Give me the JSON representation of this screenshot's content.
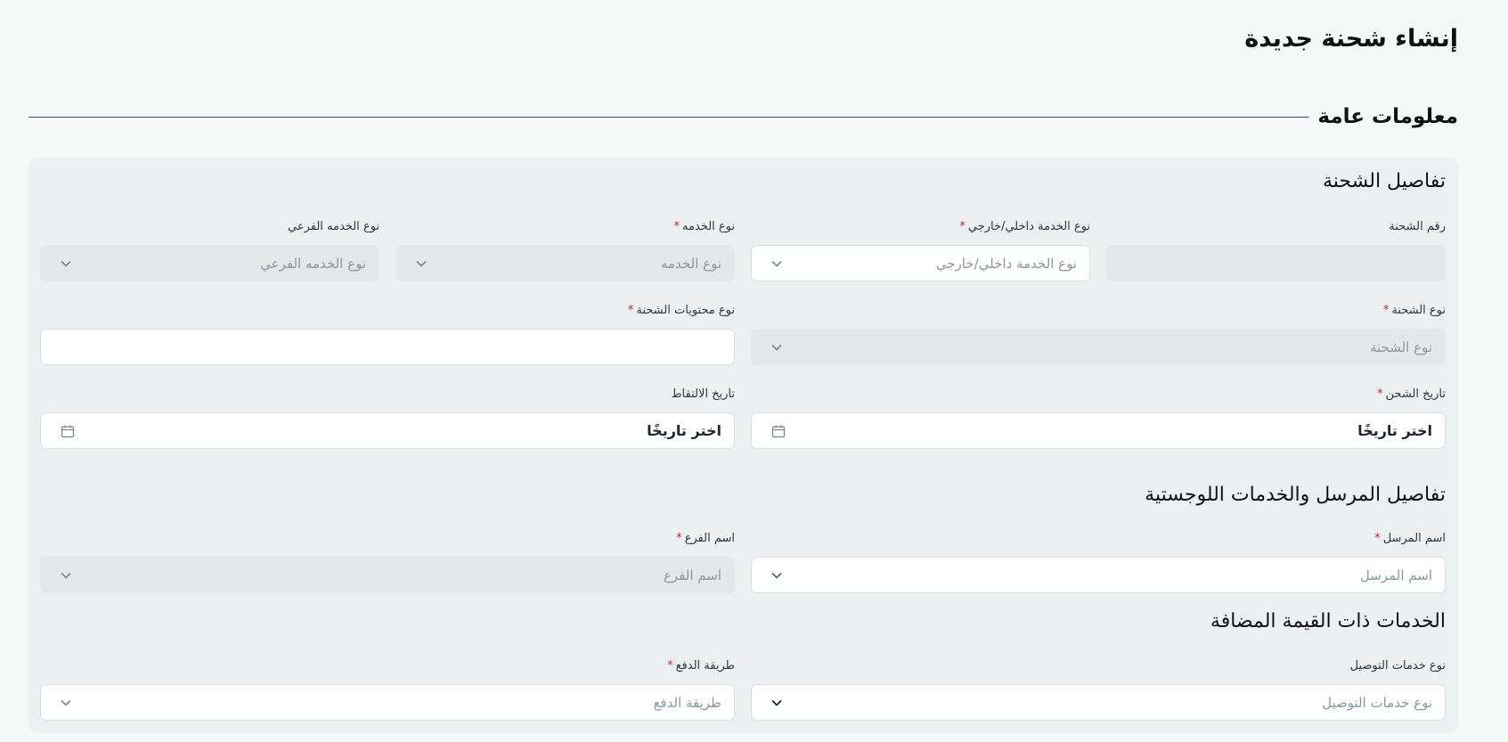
{
  "page": {
    "title": "إنشاء شحنة جديدة"
  },
  "general": {
    "section_title": "معلومات عامة"
  },
  "shipment_details": {
    "title": "تفاصيل الشحنة",
    "shipment_number": {
      "label": "رقم الشحنة",
      "value": ""
    },
    "service_scope": {
      "label": "نوع الخدمة داخلي/خارجي",
      "required": "*",
      "placeholder": "نوع الخدمة داخلي/خارجي"
    },
    "service_type": {
      "label": "نوع الخدمه",
      "required": "*",
      "placeholder": "نوع الخدمه"
    },
    "sub_service_type": {
      "label": "نوع الخدمه الفرعي",
      "placeholder": "نوع الخدمه الفرعي"
    },
    "shipment_type": {
      "label": "نوع الشحنة",
      "required": "*",
      "placeholder": "نوع الشحنة"
    },
    "contents_type": {
      "label": "نوع محتويات الشحنة",
      "required": "*",
      "value": ""
    },
    "ship_date": {
      "label": "تاريخ الشحن",
      "required": "*",
      "value": "اختر تاريخًا"
    },
    "pickup_date": {
      "label": "تاريخ الالتقاط",
      "value": "اختر تاريخًا"
    }
  },
  "sender_details": {
    "title": "تفاصيل المرسل والخدمات اللوجستية",
    "sender_name": {
      "label": "اسم المرسل",
      "required": "*",
      "placeholder": "اسم المرسل"
    },
    "branch_name": {
      "label": "اسم الفرع",
      "required": "*",
      "placeholder": "اسم الفرع"
    }
  },
  "value_added": {
    "title": "الخدمات ذات القيمة المضافة",
    "delivery_services": {
      "label": "نوع خدمات التوصيل",
      "placeholder": "نوع خدمات التوصيل"
    },
    "payment_method": {
      "label": "طريقة الدفع",
      "required": "*",
      "placeholder": "طريقة الدفع"
    }
  },
  "icons": {
    "chevron": "chevron-down-icon",
    "calendar": "calendar-icon"
  },
  "colors": {
    "accent_rule": "#1f5872",
    "required": "#d32020",
    "card_bg": "#edf0f0",
    "disabled_bg": "#e3e8e9"
  }
}
